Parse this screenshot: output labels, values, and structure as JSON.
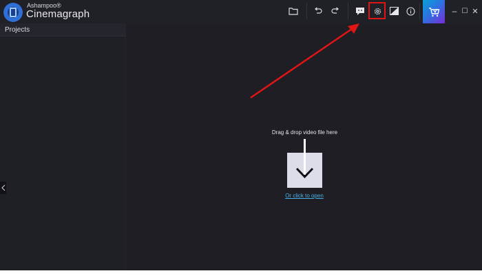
{
  "app": {
    "brand_small": "Ashampoo®",
    "brand_name": "Cinemagraph"
  },
  "toolbar": {
    "open_folder_icon": "folder-icon",
    "undo_icon": "undo-icon",
    "redo_icon": "redo-icon",
    "feedback_icon": "chat-bubble-icon",
    "settings_icon": "gear-icon",
    "compare_icon": "before-after-icon",
    "info_icon": "info-icon",
    "cart_icon": "cart-icon",
    "settings_highlight_color": "#e01616"
  },
  "window_controls": {
    "minimize": "–",
    "maximize": "☐",
    "close": "✕"
  },
  "sidebar": {
    "title": "Projects",
    "collapse_icon": "chevron-left-icon"
  },
  "main": {
    "drop_text": "Drag & drop video file here",
    "open_link": "Or click to open",
    "drop_icon": "arrow-down-icon"
  },
  "annotation": {
    "arrow_color": "#e01616"
  }
}
